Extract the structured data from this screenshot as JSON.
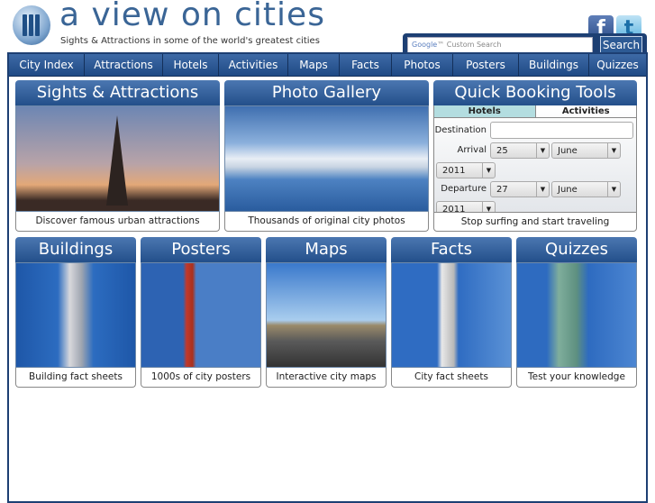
{
  "header": {
    "title": "a view on cities",
    "tagline": "Sights & Attractions in some of the world's greatest cities",
    "logo_icon": "city-columns-logo"
  },
  "social": {
    "facebook": "f",
    "twitter": "t"
  },
  "search": {
    "placeholder": "Google™ Custom Search",
    "google": "Google",
    "custom": "™ Custom Search",
    "button": "Search"
  },
  "nav": [
    "City Index",
    "Attractions",
    "Hotels",
    "Activities",
    "Maps",
    "Facts",
    "Photos",
    "Posters",
    "Buildings",
    "Quizzes"
  ],
  "panels_top": [
    {
      "title": "Sights & Attractions",
      "caption": "Discover famous urban attractions"
    },
    {
      "title": "Photo Gallery",
      "caption": "Thousands of original city photos"
    }
  ],
  "booking": {
    "title": "Quick Booking Tools",
    "tabs": [
      "Hotels",
      "Activities"
    ],
    "active_tab": "Hotels",
    "destination_label": "Destination",
    "destination_value": "",
    "arrival_label": "Arrival",
    "arrival": {
      "day": "25",
      "month": "June",
      "year": "2011"
    },
    "departure_label": "Departure",
    "departure": {
      "day": "27",
      "month": "June",
      "year": "2011"
    },
    "caption": "Stop surfing and start traveling"
  },
  "panels_bottom": [
    {
      "title": "Buildings",
      "caption": "Building fact sheets"
    },
    {
      "title": "Posters",
      "caption": "1000s of city posters"
    },
    {
      "title": "Maps",
      "caption": "Interactive city maps"
    },
    {
      "title": "Facts",
      "caption": "City fact sheets"
    },
    {
      "title": "Quizzes",
      "caption": "Test your knowledge"
    }
  ],
  "colors": {
    "navy": "#1d3f73",
    "nav": "#2d5a94",
    "tab_active": "#b3dde0"
  }
}
